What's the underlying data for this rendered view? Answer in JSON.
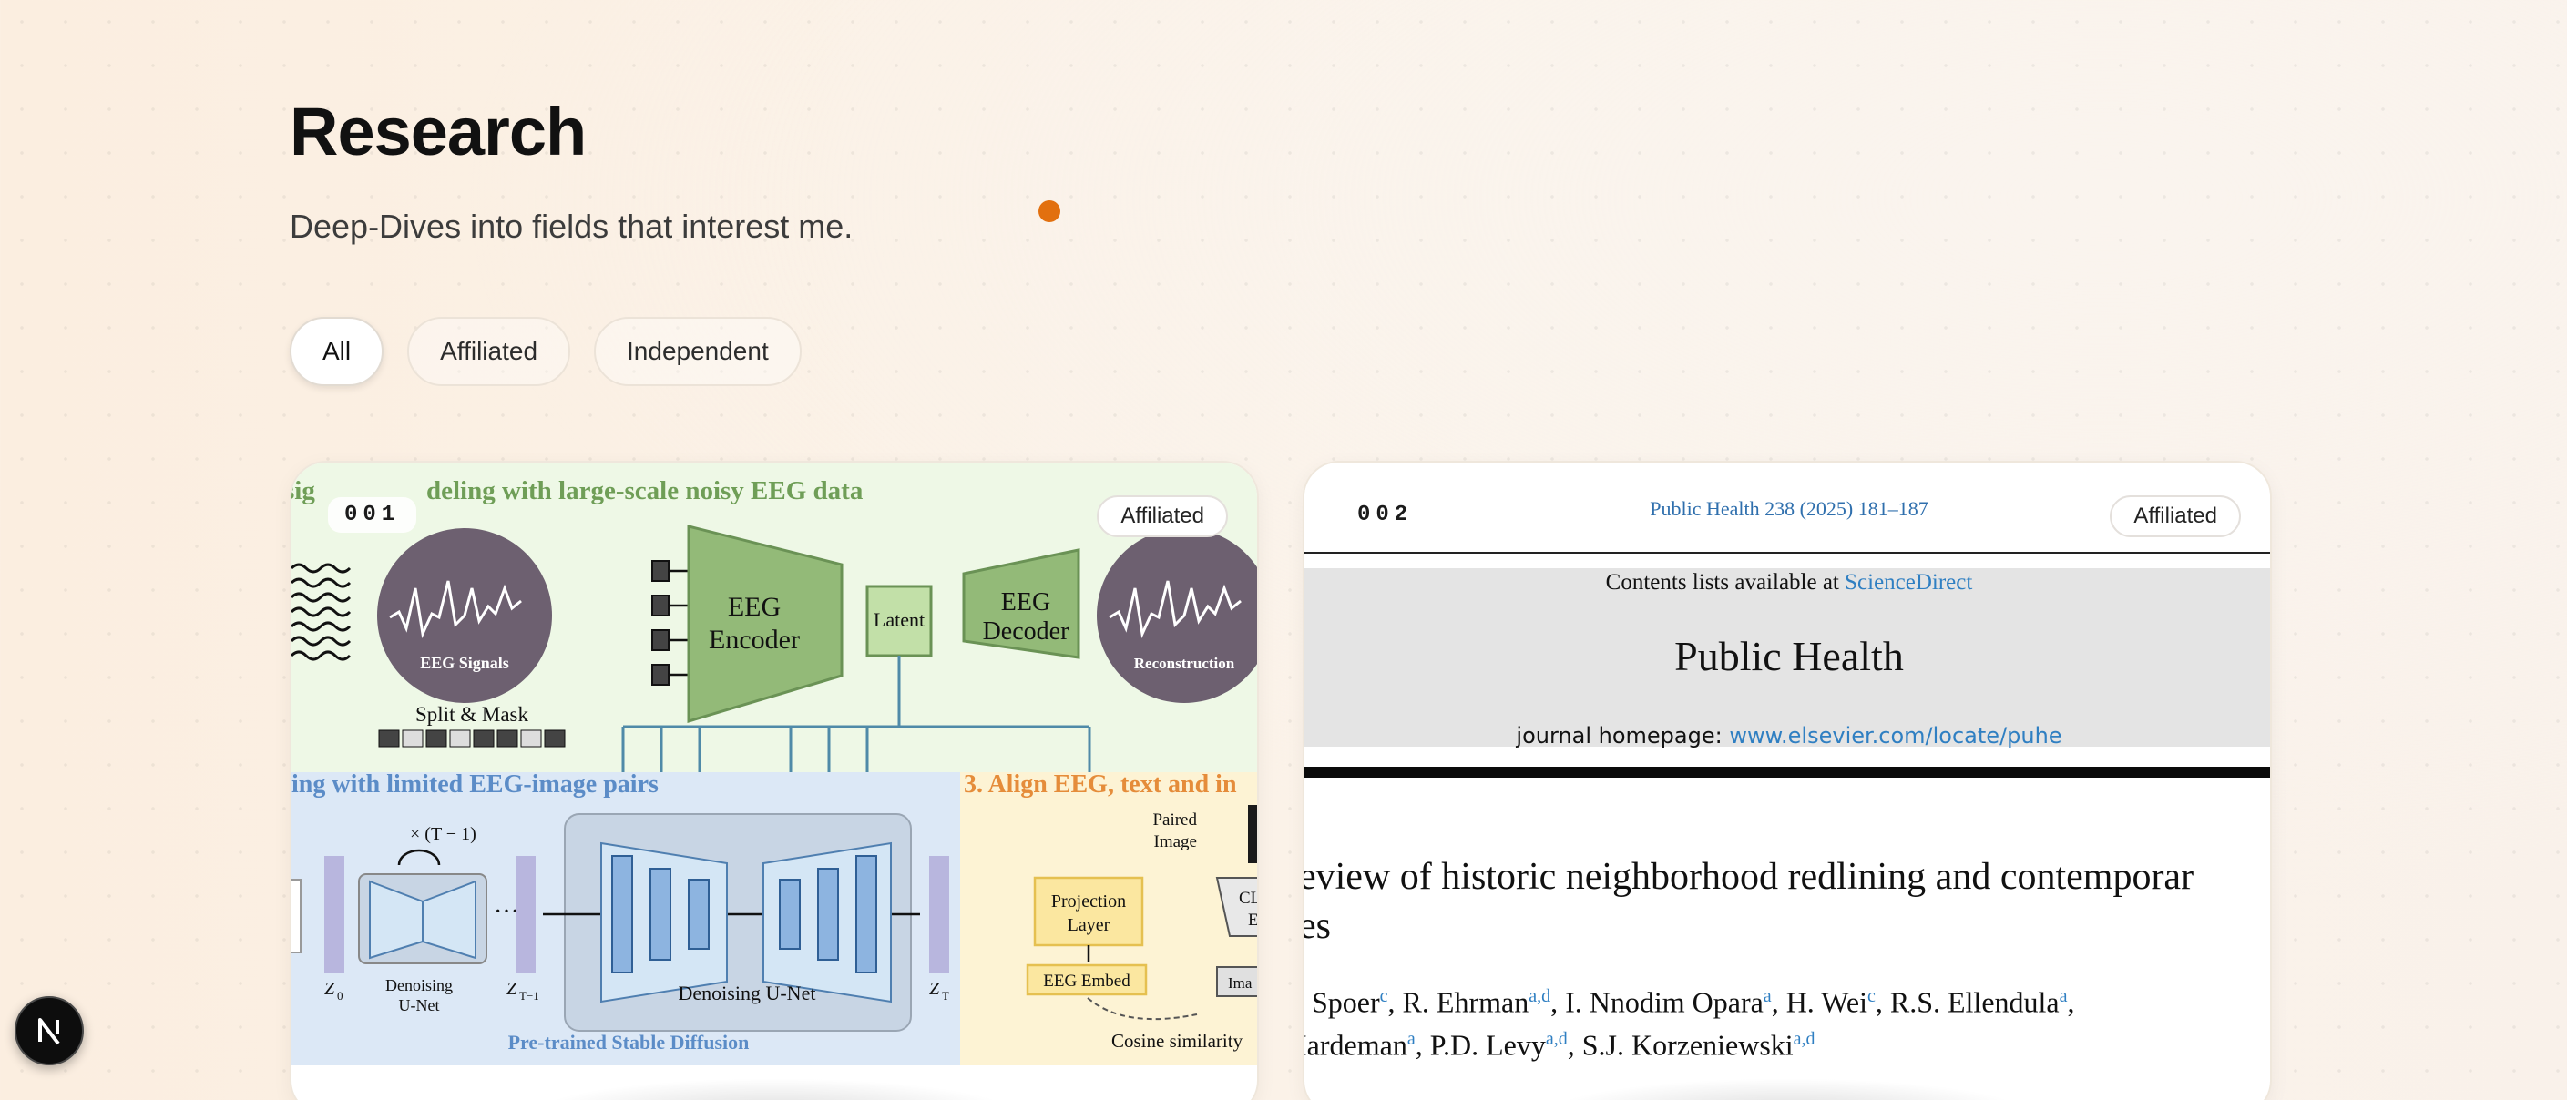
{
  "header": {
    "title": "Research",
    "subtitle": "Deep-Dives into fields that interest me."
  },
  "filters": [
    {
      "label": "All",
      "active": true
    },
    {
      "label": "Affiliated",
      "active": false
    },
    {
      "label": "Independent",
      "active": false
    }
  ],
  "cards": [
    {
      "number": "001",
      "badge": "Affiliated",
      "figure": {
        "header_left": "sig",
        "header_text": "deling with large-scale noisy EEG data",
        "eeg_signals": "EEG Signals",
        "split_mask": "Split & Mask",
        "encoder_line1": "EEG",
        "encoder_line2": "Encoder",
        "latent": "Latent",
        "decoder_line1": "EEG",
        "decoder_line2": "Decoder",
        "reconstruction": "Reconstruction",
        "section2": "ing with limited EEG-image pairs",
        "section3": "3. Align EEG, text and in",
        "times_label": "× (T − 1)",
        "z0": "Z",
        "z0_sub": "0",
        "zt1": "Z",
        "zt1_sub": "T−1",
        "zt": "Z",
        "zt_sub": "T",
        "denoising_small_line1": "Denoising",
        "denoising_small_line2": "U-Net",
        "denoising_big": "Denoising U-Net",
        "pretrained": "Pre-trained Stable Diffusion",
        "paired_line1": "Paired",
        "paired_line2": "Image",
        "projection_line1": "Projection",
        "projection_line2": "Layer",
        "eeg_embed": "EEG Embed",
        "clip_line1": "CLI",
        "clip_line2": "E",
        "ima": "Ima",
        "cosine": "Cosine similarity",
        "dots": "···"
      }
    },
    {
      "number": "002",
      "badge": "Affiliated",
      "paper": {
        "citation": "Public Health 238 (2025) 181–187",
        "contents_prefix": "Contents lists available at ",
        "contents_link": "ScienceDirect",
        "journal": "Public Health",
        "homepage_prefix": "journal homepage: ",
        "homepage_link": "www.elsevier.com/locate/puhe",
        "title_line1": "eview of historic neighborhood redlining and contemporar",
        "title_line2": "es",
        "authors": [
          {
            "name": ". Spoer",
            "sup": "c",
            "sep": ", "
          },
          {
            "name": "R. Ehrman",
            "sup": "a,d",
            "sep": ", "
          },
          {
            "name": "I. Nnodim Opara",
            "sup": "a",
            "sep": ", "
          },
          {
            "name": "H. Wei",
            "sup": "c",
            "sep": ", "
          },
          {
            "name": "R.S. Ellendula",
            "sup": "a",
            "sep": ","
          }
        ],
        "authors_line2": [
          {
            "name": "Iardeman",
            "sup": "a",
            "sep": ", "
          },
          {
            "name": "P.D. Levy",
            "sup": "a,d",
            "sep": ", "
          },
          {
            "name": "S.J. Korzeniewski",
            "sup": "a,d",
            "sep": ""
          }
        ]
      }
    }
  ],
  "dev_badge": {
    "letter": "N",
    "icon": "nextjs-logo-icon"
  },
  "colors": {
    "accent_dot": "#e2700f",
    "link_blue": "#2f7fc2"
  }
}
